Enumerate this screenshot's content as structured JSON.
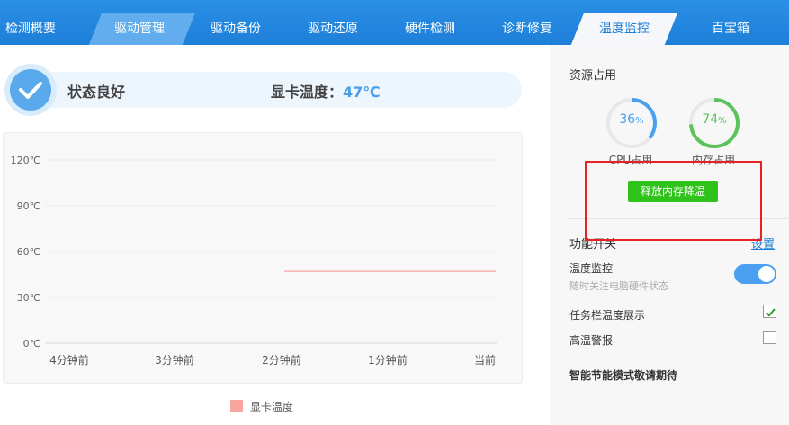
{
  "tabs": [
    {
      "label": "检测概要"
    },
    {
      "label": "驱动管理"
    },
    {
      "label": "驱动备份"
    },
    {
      "label": "驱动还原"
    },
    {
      "label": "硬件检测"
    },
    {
      "label": "诊断修复"
    },
    {
      "label": "温度监控"
    },
    {
      "label": "百宝箱"
    }
  ],
  "active_tab": "温度监控",
  "status": {
    "text": "状态良好",
    "gpu_label": "显卡温度：",
    "gpu_value": "47℃"
  },
  "chart_data": {
    "type": "line",
    "x_ticks": [
      "4分钟前",
      "3分钟前",
      "2分钟前",
      "1分钟前",
      "当前"
    ],
    "y_ticks": [
      "120℃",
      "90℃",
      "60℃",
      "30℃",
      "0℃"
    ],
    "ylim": [
      0,
      120
    ],
    "grid": true,
    "legend_position": "bottom",
    "series": [
      {
        "name": "显卡温度",
        "color": "#f8a49f",
        "x_range": [
          "2分钟前",
          "当前"
        ],
        "values": [
          47,
          47
        ]
      }
    ]
  },
  "resource": {
    "title": "资源占用",
    "cpu": {
      "value": 36,
      "unit": "%",
      "label": "CPU占用",
      "color": "#4a9ff0"
    },
    "mem": {
      "value": 74,
      "unit": "%",
      "label": "内存占用",
      "color": "#5cc35c"
    },
    "release_button": "释放内存降温"
  },
  "functions": {
    "title": "功能开关",
    "settings_link": "设置",
    "temp_monitor": {
      "label": "温度监控",
      "sub": "随时关注电脑硬件状态",
      "enabled": true
    },
    "taskbar_temp": {
      "label": "任务栏温度展示",
      "checked": true
    },
    "high_temp_alarm": {
      "label": "高温警报",
      "checked": false
    },
    "footer": "智能节能模式敬请期待"
  },
  "colors": {
    "tab_bar": "#1e7fd8",
    "accent": "#4a9ff0",
    "button_green": "#2ec21a",
    "highlight_red": "#e62222"
  }
}
